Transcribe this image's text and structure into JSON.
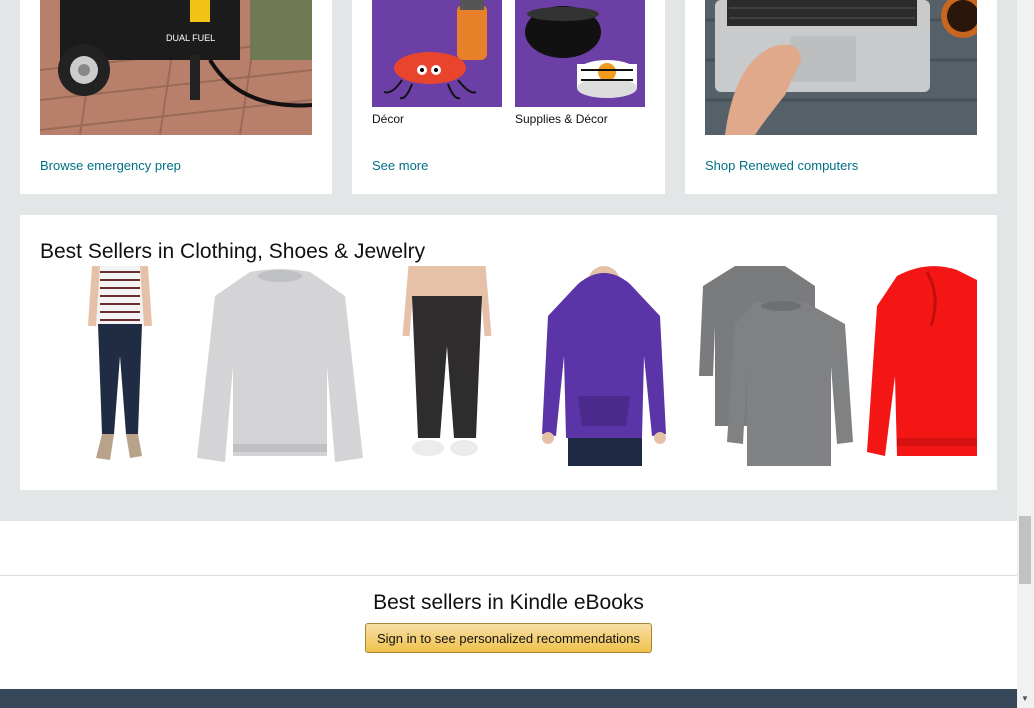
{
  "cards_top": {
    "emergency": {
      "link": "Browse emergency prep"
    },
    "halloween": {
      "tiles": [
        {
          "caption": "Décor"
        },
        {
          "caption": "Supplies & Décor"
        }
      ],
      "link": "See more"
    },
    "renewed": {
      "link": "Shop Renewed computers"
    }
  },
  "best_sellers_clothing": {
    "title": "Best Sellers in Clothing, Shoes & Jewelry",
    "products": [
      {
        "icon": "womens-jeans"
      },
      {
        "icon": "gray-crewneck-sweatshirt"
      },
      {
        "icon": "womens-black-pants"
      },
      {
        "icon": "purple-hoodie"
      },
      {
        "icon": "gray-long-sleeve-shirts"
      },
      {
        "icon": "red-hoodie"
      }
    ]
  },
  "kindle": {
    "title": "Best sellers in Kindle eBooks",
    "button_label": "Sign in to see personalized recommendations"
  },
  "colors": {
    "page_background": "#e3e6e6",
    "link": "#007185",
    "button_yellow": "#f0c14b",
    "footer": "#37475a"
  }
}
